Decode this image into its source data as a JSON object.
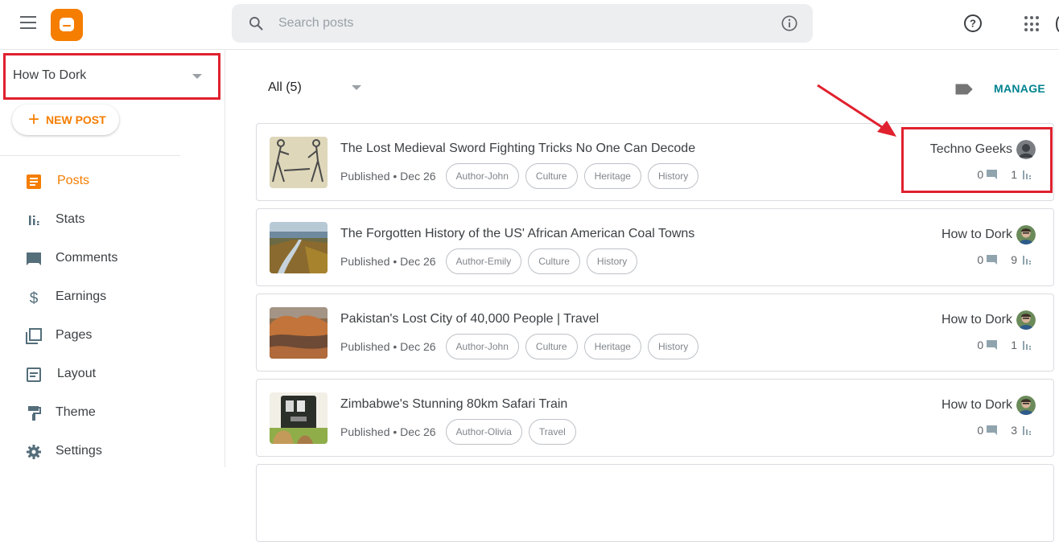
{
  "header": {
    "menu_icon": "hamburger-menu-icon",
    "logo": "blogger-logo",
    "search": {
      "placeholder": "Search posts",
      "value": ""
    },
    "search_icon": "search-icon",
    "info_icon": "info-icon",
    "help_icon": "help-icon",
    "apps_icon": "apps-grid-icon"
  },
  "sidebar": {
    "blog_name": "How To Dork",
    "new_post_label": "NEW POST",
    "items": [
      {
        "label": "Posts",
        "icon": "posts-icon",
        "active": true
      },
      {
        "label": "Stats",
        "icon": "stats-icon"
      },
      {
        "label": "Comments",
        "icon": "comments-icon"
      },
      {
        "label": "Earnings",
        "icon": "dollar-icon"
      },
      {
        "label": "Pages",
        "icon": "pages-icon"
      },
      {
        "label": "Layout",
        "icon": "layout-icon"
      },
      {
        "label": "Theme",
        "icon": "paint-roller-icon"
      },
      {
        "label": "Settings",
        "icon": "gear-icon"
      }
    ]
  },
  "main": {
    "filter_label": "All (5)",
    "manage_label": "MANAGE",
    "posts": [
      {
        "title": "The Lost Medieval Sword Fighting Tricks No One Can Decode",
        "status": "Published • Dec 26",
        "tags": [
          "Author-John",
          "Culture",
          "Heritage",
          "History"
        ],
        "author": "Techno Geeks",
        "comments": "0",
        "views": "1"
      },
      {
        "title": "The Forgotten History of the US' African American Coal Towns",
        "status": "Published • Dec 26",
        "tags": [
          "Author-Emily",
          "Culture",
          "History"
        ],
        "author": "How to Dork",
        "comments": "0",
        "views": "9"
      },
      {
        "title": "Pakistan's Lost City of 40,000 People | Travel",
        "status": "Published • Dec 26",
        "tags": [
          "Author-John",
          "Culture",
          "Heritage",
          "History"
        ],
        "author": "How to Dork",
        "comments": "0",
        "views": "1"
      },
      {
        "title": "Zimbabwe's Stunning 80km Safari Train",
        "status": "Published • Dec 26",
        "tags": [
          "Author-Olivia",
          "Travel"
        ],
        "author": "How to Dork",
        "comments": "0",
        "views": "3"
      }
    ]
  },
  "colors": {
    "brand_orange": "#f57d00",
    "manage_teal": "#00838f",
    "annotation_red": "#e0212e"
  }
}
